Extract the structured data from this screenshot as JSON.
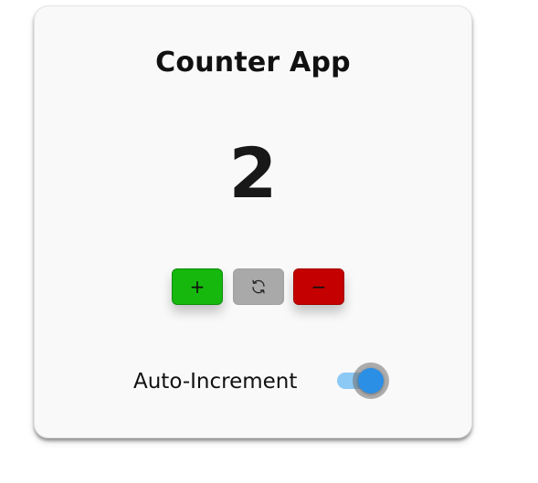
{
  "app": {
    "title": "Counter App"
  },
  "counter": {
    "value": "2"
  },
  "buttons": {
    "increment_label": "+",
    "reset_icon": "refresh-icon",
    "decrement_label": "−"
  },
  "auto_increment": {
    "label": "Auto-Increment",
    "enabled": true
  },
  "colors": {
    "increment": "#16b80e",
    "reset": "#a9a9a9",
    "decrement": "#c40000",
    "toggle_on": "#2b8fe5",
    "toggle_track": "#8dc9f5"
  }
}
